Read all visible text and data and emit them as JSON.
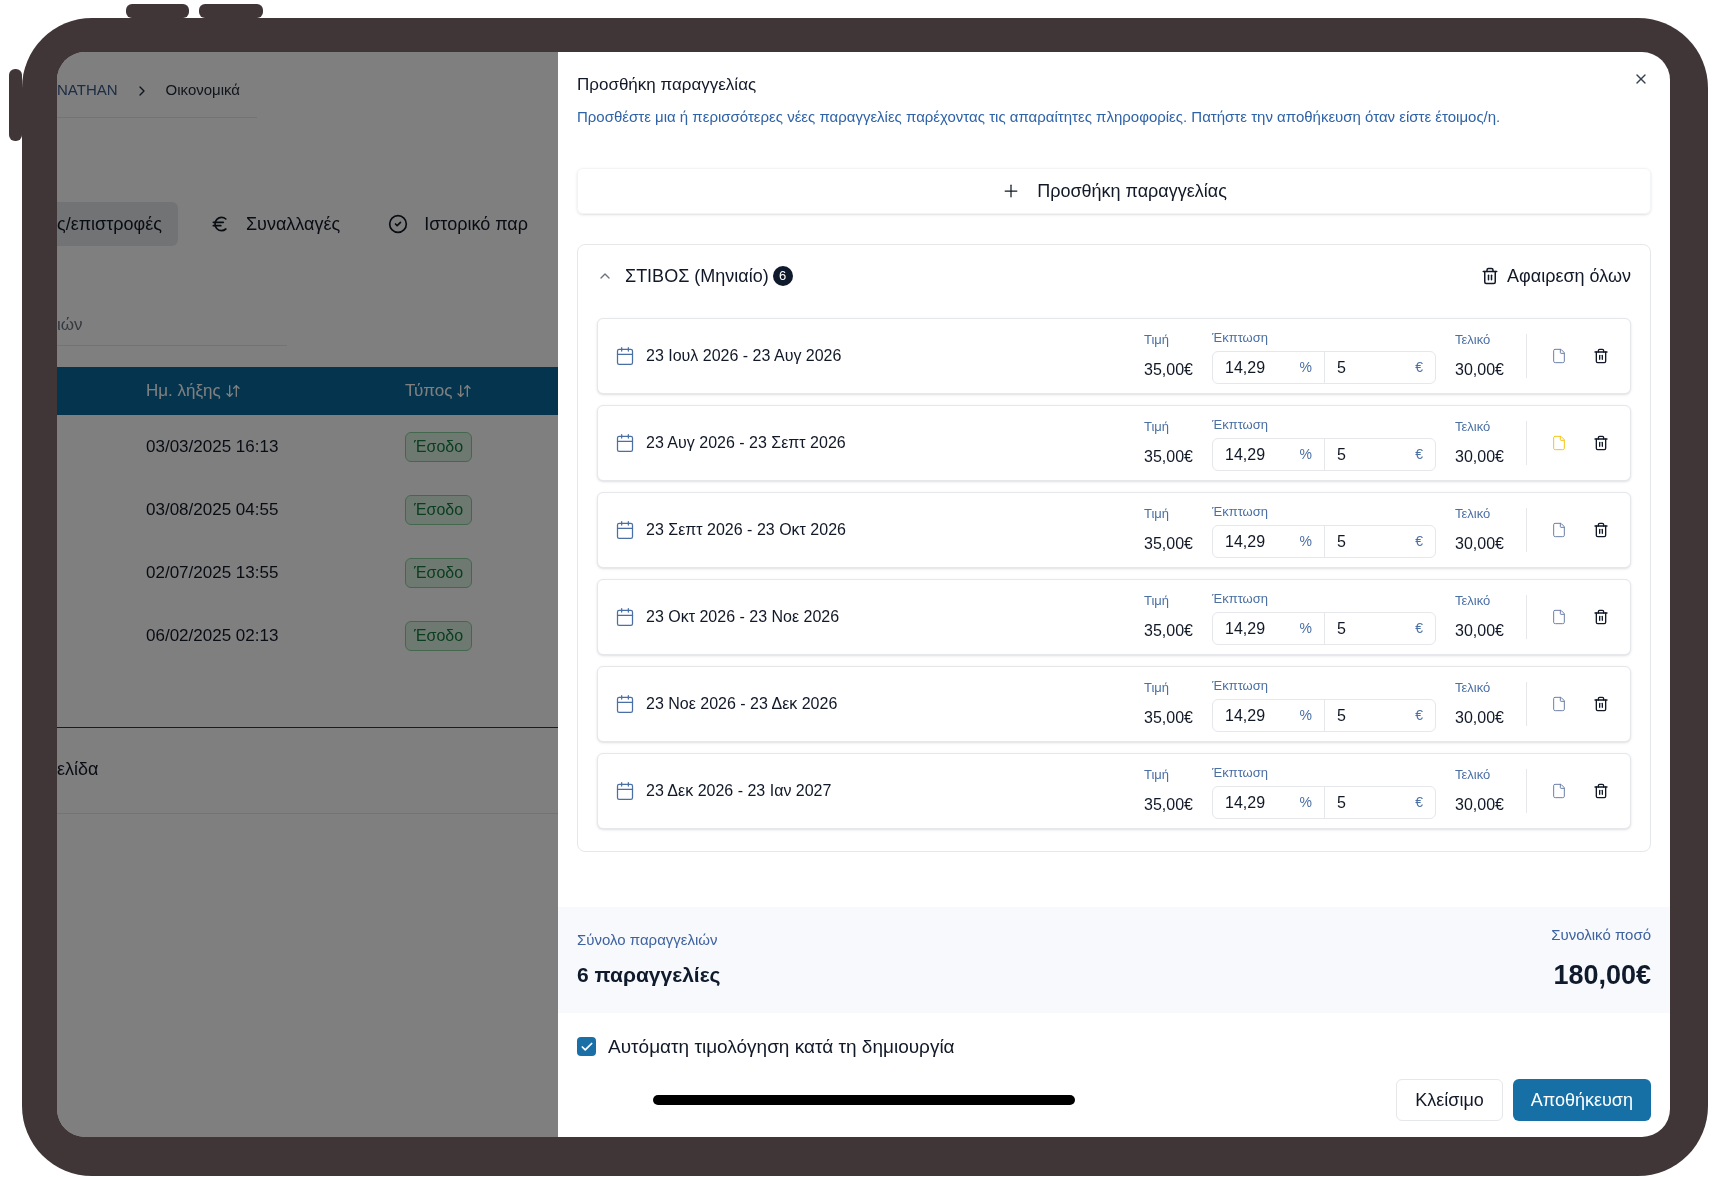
{
  "background": {
    "breadcrumb": [
      "NATHAN",
      "Οικονομικά"
    ],
    "tabs": [
      {
        "label": "ς/επιστροφές",
        "kind": "plain",
        "selected": true
      },
      {
        "label": "Συναλλαγές",
        "kind": "euro",
        "selected": false
      },
      {
        "label": "Ιστορικό παρ",
        "kind": "check",
        "selected": false
      }
    ],
    "search_placeholder": "ιών",
    "table": {
      "columns": [
        "Ημ. λήξης",
        "Τύπος"
      ],
      "rows": [
        {
          "date": "03/03/2025 16:13",
          "type": "Έσοδο"
        },
        {
          "date": "03/08/2025 04:55",
          "type": "Έσοδο"
        },
        {
          "date": "02/07/2025 13:55",
          "type": "Έσοδο"
        },
        {
          "date": "06/02/2025 02:13",
          "type": "Έσοδο"
        }
      ]
    },
    "footer_text": "ελίδα"
  },
  "modal": {
    "title": "Προσθήκη παραγγελίας",
    "description": "Προσθέστε μια ή περισσότερες νέες παραγγελίες παρέχοντας τις απαραίτητες πληροφορίες. Πατήστε την αποθήκευση όταν είστε έτοιμος/η.",
    "add_button": "Προσθήκη παραγγελίας",
    "group": {
      "title": "ΣΤΙΒΟΣ (Μηνιαίο)",
      "count": "6",
      "expanded": true,
      "remove_all": "Αφαιρεση όλων",
      "items": [
        {
          "date": "23 Ιουλ 2026 - 23 Αυγ 2026",
          "price_label": "Τιμή",
          "price": "35,00€",
          "discount_label": "Έκπτωση",
          "discount_percent": "14,29",
          "percent_sign": "%",
          "discount_amount": "5",
          "currency_sign": "€",
          "final_label": "Τελικό",
          "final": "30,00€",
          "note_active": false
        },
        {
          "date": "23 Αυγ 2026 - 23 Σεπτ 2026",
          "price_label": "Τιμή",
          "price": "35,00€",
          "discount_label": "Έκπτωση",
          "discount_percent": "14,29",
          "percent_sign": "%",
          "discount_amount": "5",
          "currency_sign": "€",
          "final_label": "Τελικό",
          "final": "30,00€",
          "note_active": true
        },
        {
          "date": "23 Σεπτ 2026 - 23 Οκτ 2026",
          "price_label": "Τιμή",
          "price": "35,00€",
          "discount_label": "Έκπτωση",
          "discount_percent": "14,29",
          "percent_sign": "%",
          "discount_amount": "5",
          "currency_sign": "€",
          "final_label": "Τελικό",
          "final": "30,00€",
          "note_active": false
        },
        {
          "date": "23 Οκτ 2026 - 23 Νοε 2026",
          "price_label": "Τιμή",
          "price": "35,00€",
          "discount_label": "Έκπτωση",
          "discount_percent": "14,29",
          "percent_sign": "%",
          "discount_amount": "5",
          "currency_sign": "€",
          "final_label": "Τελικό",
          "final": "30,00€",
          "note_active": false
        },
        {
          "date": "23 Νοε 2026 - 23 Δεκ 2026",
          "price_label": "Τιμή",
          "price": "35,00€",
          "discount_label": "Έκπτωση",
          "discount_percent": "14,29",
          "percent_sign": "%",
          "discount_amount": "5",
          "currency_sign": "€",
          "final_label": "Τελικό",
          "final": "30,00€",
          "note_active": false
        },
        {
          "date": "23 Δεκ 2026 - 23 Ιαν 2027",
          "price_label": "Τιμή",
          "price": "35,00€",
          "discount_label": "Έκπτωση",
          "discount_percent": "14,29",
          "percent_sign": "%",
          "discount_amount": "5",
          "currency_sign": "€",
          "final_label": "Τελικό",
          "final": "30,00€",
          "note_active": false
        }
      ]
    },
    "summary": {
      "orders_label": "Σύνολο παραγγελιών",
      "orders_value": "6 παραγγελίες",
      "total_label": "Συνολικό ποσό",
      "total_value": "180,00€"
    },
    "auto_invoice": {
      "label": "Αυτόματη τιμολόγηση κατά τη δημιουργία",
      "checked": true
    },
    "buttons": {
      "close": "Κλείσιμο",
      "save": "Αποθήκευση"
    }
  }
}
